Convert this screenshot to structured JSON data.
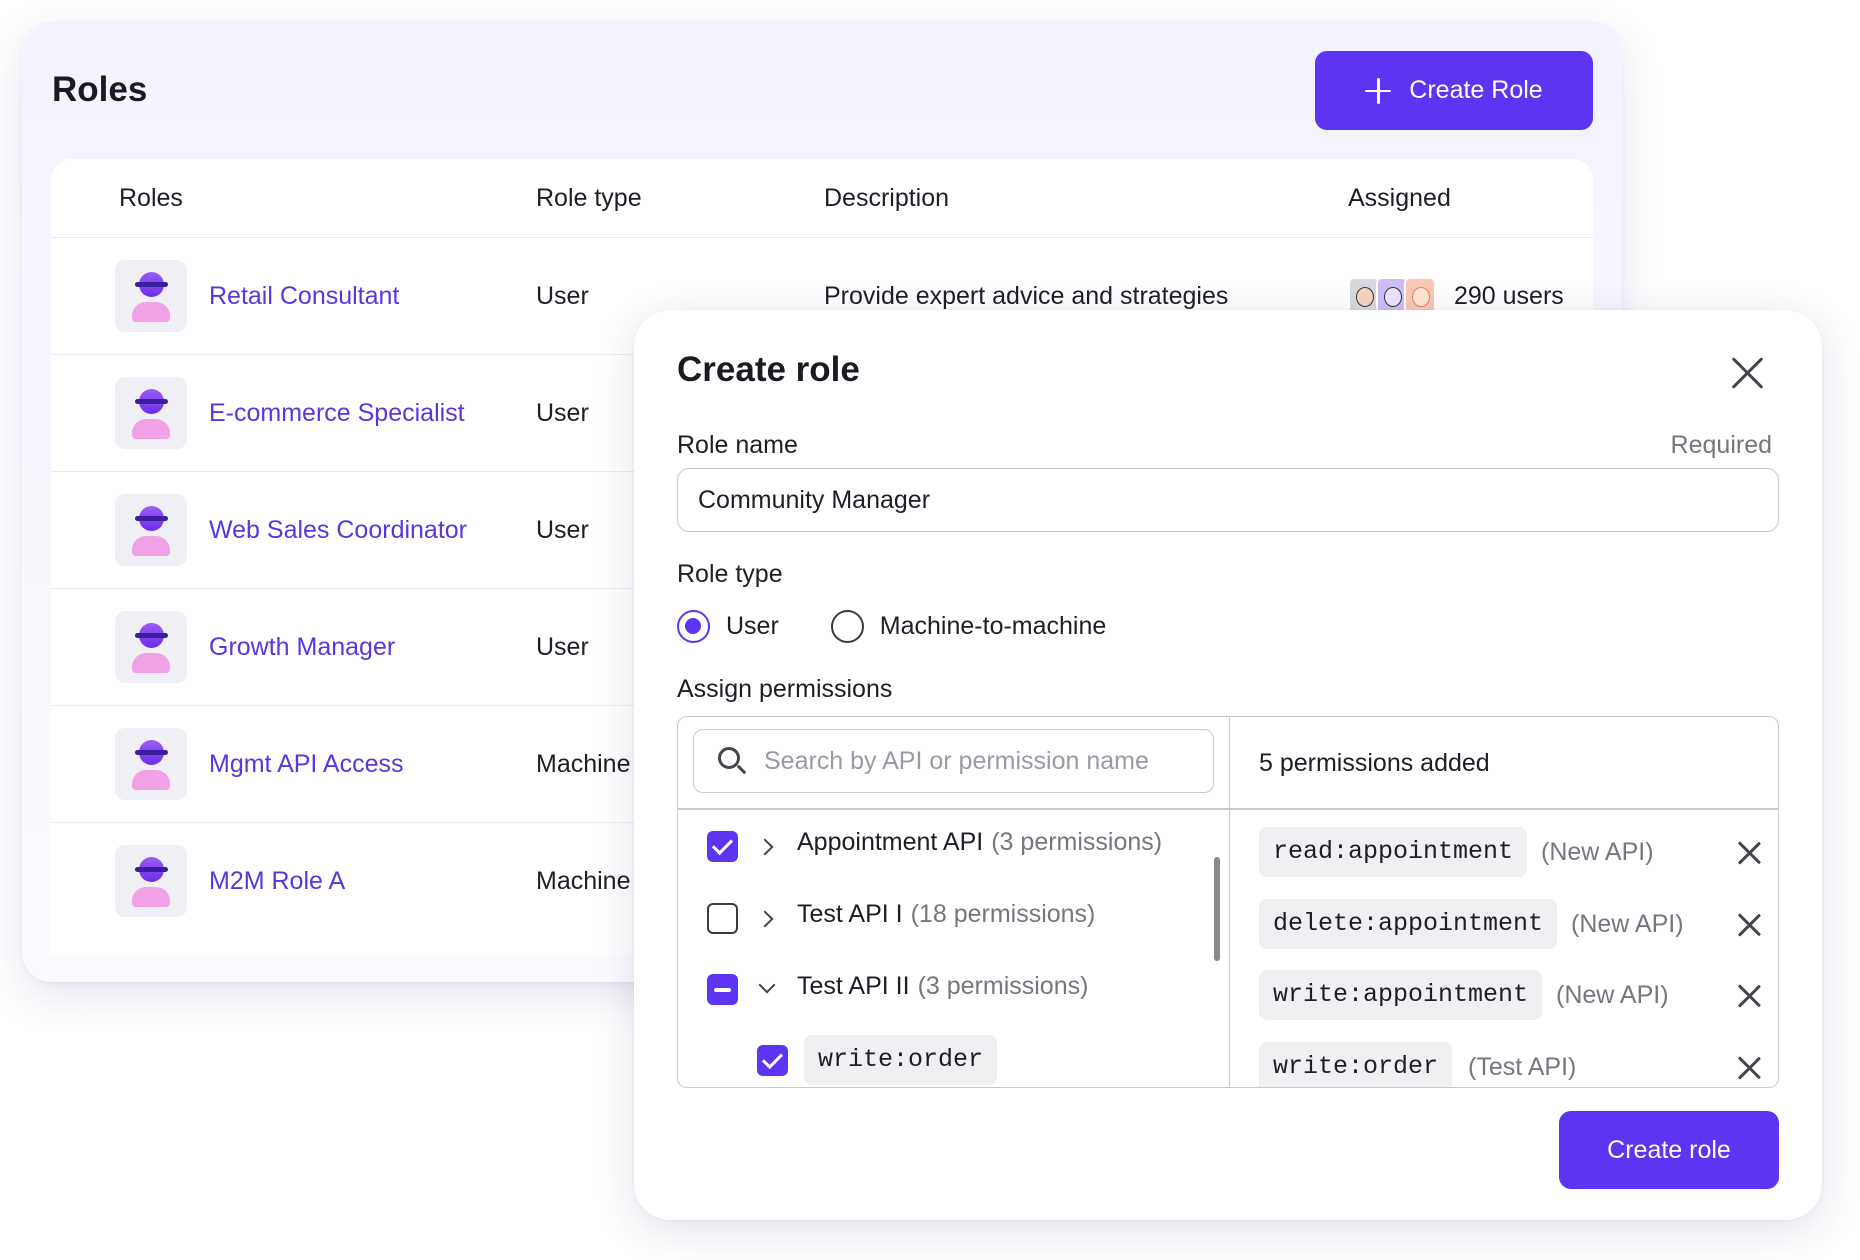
{
  "roles_page": {
    "title": "Roles",
    "create_button_label": "Create Role",
    "columns": [
      "Roles",
      "Role type",
      "Description",
      "Assigned"
    ],
    "rows": [
      {
        "name": "Retail Consultant",
        "type": "User",
        "description": "Provide expert advice and strategies",
        "assigned": "290 users"
      },
      {
        "name": "E-commerce Specialist",
        "type": "User",
        "description": "",
        "assigned": ""
      },
      {
        "name": "Web Sales Coordinator",
        "type": "User",
        "description": "",
        "assigned": ""
      },
      {
        "name": "Growth Manager",
        "type": "User",
        "description": "",
        "assigned": ""
      },
      {
        "name": "Mgmt API Access",
        "type": "Machine",
        "description": "",
        "assigned": ""
      },
      {
        "name": "M2M Role A",
        "type": "Machine",
        "description": "",
        "assigned": ""
      }
    ]
  },
  "modal": {
    "title": "Create role",
    "role_name_label": "Role name",
    "required_label": "Required",
    "role_name_value": "Community Manager",
    "role_type_label": "Role type",
    "role_type_options": [
      {
        "label": "User",
        "selected": true
      },
      {
        "label": "Machine-to-machine",
        "selected": false
      }
    ],
    "assign_permissions_label": "Assign permissions",
    "search_placeholder": "Search by API or permission name",
    "apis": [
      {
        "name": "Appointment API",
        "count": "(3 permissions)",
        "state": "checked",
        "expanded": false
      },
      {
        "name": "Test API I",
        "count": "(18 permissions)",
        "state": "unchecked",
        "expanded": false
      },
      {
        "name": "Test API II",
        "count": "(3 permissions)",
        "state": "partial",
        "expanded": true
      }
    ],
    "sub_permissions": [
      {
        "name": "write:order",
        "state": "checked"
      }
    ],
    "added_summary": "5 permissions added",
    "added_permissions": [
      {
        "name": "read:appointment",
        "source": "(New API)"
      },
      {
        "name": "delete:appointment",
        "source": "(New API)"
      },
      {
        "name": "write:appointment",
        "source": "(New API)"
      },
      {
        "name": "write:order",
        "source": "(Test API)"
      }
    ],
    "submit_label": "Create role"
  },
  "colors": {
    "accent": "#5d34f2",
    "link": "#5a35e0",
    "muted_text": "#76767f"
  }
}
